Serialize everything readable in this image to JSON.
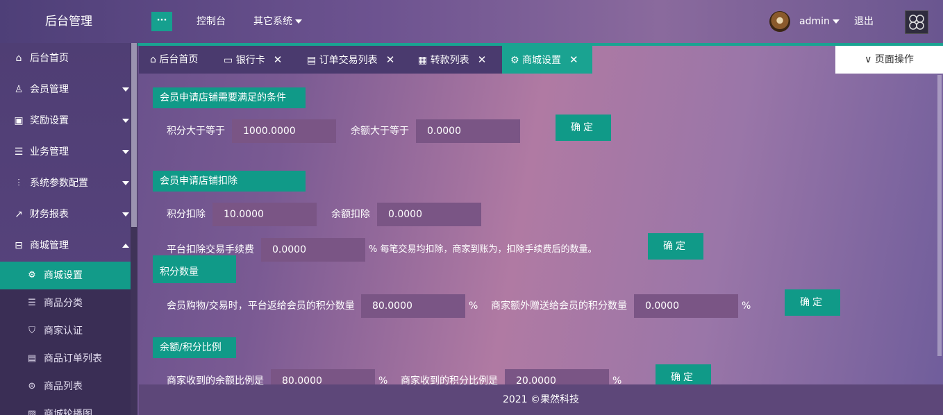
{
  "header": {
    "brand": "后台管理",
    "toggle": "···",
    "console": "控制台",
    "other_systems": "其它系统",
    "user": "admin",
    "logout": "退出"
  },
  "sidebar": {
    "items": [
      {
        "label": "后台首页",
        "icon": "home-icon"
      },
      {
        "label": "会员管理",
        "icon": "user-icon"
      },
      {
        "label": "奖励设置",
        "icon": "gift-icon"
      },
      {
        "label": "业务管理",
        "icon": "list-icon"
      },
      {
        "label": "系统参数配置",
        "icon": "sliders-icon"
      },
      {
        "label": "财务报表",
        "icon": "chart-icon"
      },
      {
        "label": "商城管理",
        "icon": "shop-icon"
      }
    ],
    "sub_items": [
      {
        "label": "商城设置",
        "icon": "gear-icon"
      },
      {
        "label": "商品分类",
        "icon": "list-icon"
      },
      {
        "label": "商家认证",
        "icon": "shield-icon"
      },
      {
        "label": "商品订单列表",
        "icon": "document-icon"
      },
      {
        "label": "商品列表",
        "icon": "circle-list-icon"
      },
      {
        "label": "商城轮播图",
        "icon": "image-icon"
      }
    ]
  },
  "tabs": [
    {
      "label": "后台首页",
      "icon": "home-icon",
      "closable": false
    },
    {
      "label": "银行卡",
      "icon": "card-icon",
      "closable": true
    },
    {
      "label": "订单交易列表",
      "icon": "document-icon",
      "closable": true
    },
    {
      "label": "转款列表",
      "icon": "transfer-icon",
      "closable": true
    },
    {
      "label": "商城设置",
      "icon": "gear-icon",
      "closable": true
    }
  ],
  "page_ops": "页面操作",
  "sections": {
    "s1": {
      "title": "会员申请店铺需要满足的条件",
      "points_label": "积分大于等于",
      "points_value": "1000.0000",
      "balance_label": "余额大于等于",
      "balance_value": "0.0000",
      "button": "确定"
    },
    "s2": {
      "title": "会员申请店铺扣除",
      "points_label": "积分扣除",
      "points_value": "10.0000",
      "balance_label": "余额扣除",
      "balance_value": "0.0000",
      "fee_label": "平台扣除交易手续费",
      "fee_value": "0.0000",
      "fee_note": "% 每笔交易均扣除，商家到账为，扣除手续费后的数量。",
      "button": "确定"
    },
    "s3": {
      "title": "积分数量",
      "return_label": "会员购物/交易时，平台返给会员的积分数量",
      "return_value": "80.0000",
      "pct": "%",
      "extra_label": "商家额外赠送给会员的积分数量",
      "extra_value": "0.0000",
      "button": "确定"
    },
    "s4": {
      "title": "余额/积分比例",
      "balance_ratio_label": "商家收到的余额比例是",
      "balance_ratio_value": "80.0000",
      "points_ratio_label": "商家收到的积分比例是",
      "points_ratio_value": "20.0000",
      "pct": "%",
      "button": "确定"
    }
  },
  "footer": "2021 ©果然科技"
}
